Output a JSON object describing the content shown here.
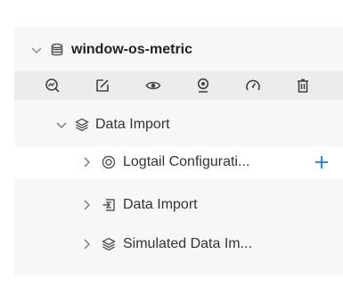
{
  "project": {
    "name": "window-os-metric",
    "icon": "database-icon"
  },
  "toolbar": {
    "items": [
      {
        "name": "search-query-icon"
      },
      {
        "name": "edit-icon"
      },
      {
        "name": "eye-icon"
      },
      {
        "name": "location-pin-icon"
      },
      {
        "name": "dashboard-gauge-icon"
      },
      {
        "name": "delete-icon"
      }
    ]
  },
  "tree": {
    "group": {
      "label": "Data Import",
      "icon": "layers-icon"
    },
    "children": [
      {
        "label": "Logtail Configurati...",
        "icon": "target-icon",
        "action": "plus-icon"
      },
      {
        "label": "Data Import",
        "icon": "import-icon"
      },
      {
        "label": "Simulated Data Im...",
        "icon": "layers-icon"
      }
    ]
  },
  "colors": {
    "accent": "#1677ff",
    "panel": "#f7f7f7",
    "toolbar": "#ececec"
  }
}
